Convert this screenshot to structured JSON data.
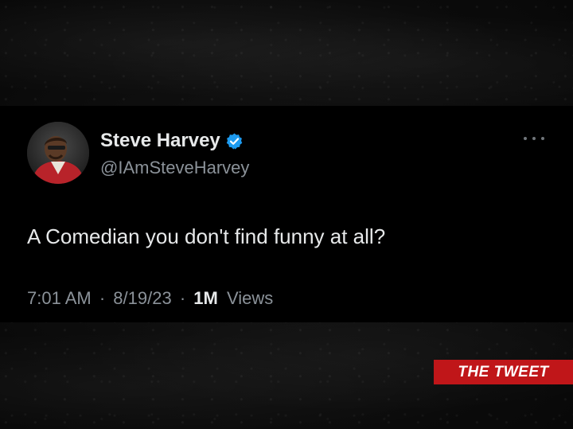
{
  "tweet": {
    "display_name": "Steve Harvey",
    "handle": "@IAmSteveHarvey",
    "verified": true,
    "text": "A Comedian you don't find funny at all?",
    "time": "7:01 AM",
    "separator": "·",
    "date": "8/19/23",
    "views_count": "1M",
    "views_label": "Views",
    "more_icon": "more-horizontal-icon",
    "verified_icon": "verified-badge-icon"
  },
  "overlay": {
    "label": "THE TWEET"
  },
  "colors": {
    "card_background": "#000000",
    "primary_text": "#e7e9ea",
    "secondary_text": "#8b9299",
    "verified_blue": "#1d9bf0",
    "badge_red": "#c01619"
  }
}
